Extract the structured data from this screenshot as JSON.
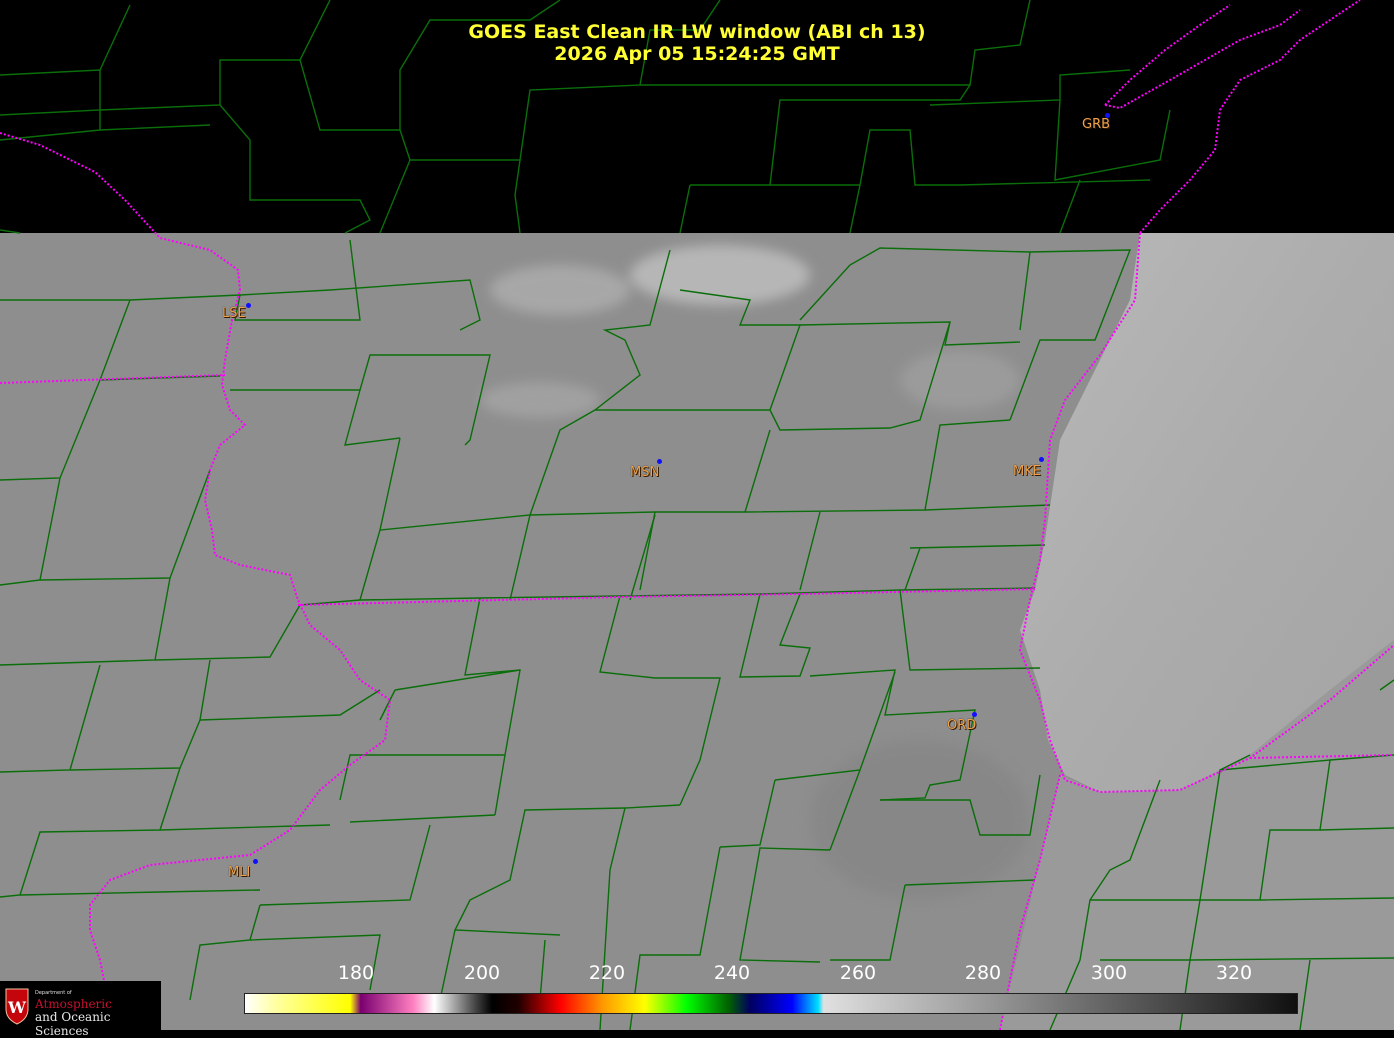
{
  "title": {
    "line1": "GOES East Clean IR LW window (ABI ch 13)",
    "line2": "2026 Apr 05  15:24:25 GMT"
  },
  "stations": [
    {
      "code": "GRB"
    },
    {
      "code": "LSE"
    },
    {
      "code": "MSN"
    },
    {
      "code": "MKE"
    },
    {
      "code": "ORD"
    },
    {
      "code": "MLI"
    }
  ],
  "colorbar": {
    "ticks": [
      "180",
      "200",
      "220",
      "240",
      "260",
      "280",
      "300",
      "320"
    ]
  },
  "logo": {
    "dept": "Department of",
    "line1": "Atmospheric",
    "line2": "and Oceanic Sciences"
  },
  "colors": {
    "county_lines": "#0a6e0a",
    "state_lines": "#ff00ff",
    "title_text": "#ffff33",
    "station_text": "#f0a24a",
    "station_dot": "#1010ff"
  }
}
